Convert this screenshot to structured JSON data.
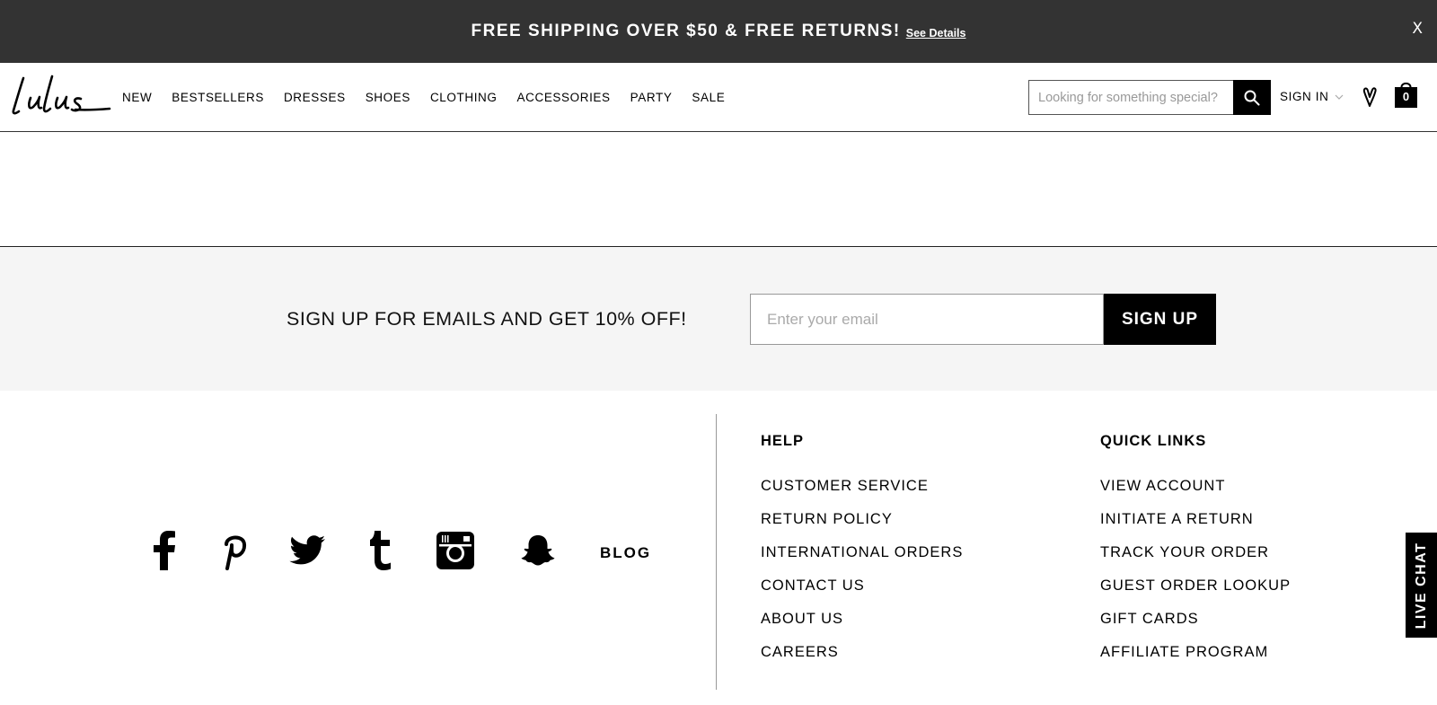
{
  "promo": {
    "text": "FREE SHIPPING OVER $50 & FREE RETURNS!",
    "link": "See Details",
    "close": "X"
  },
  "header": {
    "logo_alt": "Lulus",
    "nav": [
      "NEW",
      "BESTSELLERS",
      "DRESSES",
      "SHOES",
      "CLOTHING",
      "ACCESSORIES",
      "PARTY",
      "SALE"
    ],
    "search_placeholder": "Looking for something special?",
    "sign_in": "SIGN IN",
    "bag_count": "0"
  },
  "signup": {
    "text": "SIGN UP FOR EMAILS AND GET 10% OFF!",
    "placeholder": "Enter your email",
    "button": "SIGN UP"
  },
  "social": {
    "icons": [
      "facebook-icon",
      "pinterest-icon",
      "twitter-icon",
      "tumblr-icon",
      "instagram-icon",
      "snapchat-icon"
    ],
    "blog": "BLOG"
  },
  "footer": {
    "help": {
      "heading": "HELP",
      "links": [
        "CUSTOMER SERVICE",
        "RETURN POLICY",
        "INTERNATIONAL ORDERS",
        "CONTACT US",
        "ABOUT US",
        "CAREERS"
      ]
    },
    "quick_links": {
      "heading": "QUICK LINKS",
      "links": [
        "VIEW ACCOUNT",
        "INITIATE A RETURN",
        "TRACK YOUR ORDER",
        "GUEST ORDER LOOKUP",
        "GIFT CARDS",
        "AFFILIATE PROGRAM"
      ]
    }
  },
  "live_chat": "LIVE CHAT",
  "colors": {
    "promo_bg": "#333333",
    "signup_bg": "#f5f5f5",
    "button_bg": "#000000"
  }
}
